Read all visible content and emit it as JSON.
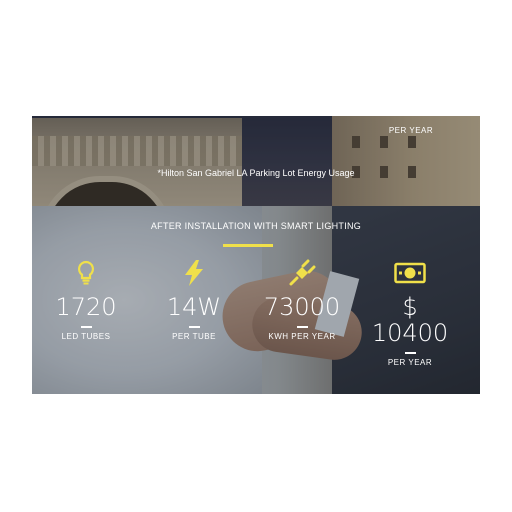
{
  "top_section": {
    "per_year_label": "PER YEAR",
    "caption": "*Hilton San Gabriel LA Parking Lot Energy Usage"
  },
  "after_section": {
    "title": "AFTER INSTALLATION WITH SMART LIGHTING",
    "accent_color": "#f0e04a",
    "stats": [
      {
        "icon": "lightbulb-icon",
        "value": "1720",
        "label": "LED TUBES"
      },
      {
        "icon": "lightning-bolt-icon",
        "value": "14W",
        "label": "PER TUBE"
      },
      {
        "icon": "power-plug-icon",
        "value": "73000",
        "label": "KWH PER YEAR"
      },
      {
        "icon": "dollar-bill-icon",
        "value_line1": "$",
        "value_line2": "10400",
        "label": "PER YEAR"
      }
    ]
  }
}
